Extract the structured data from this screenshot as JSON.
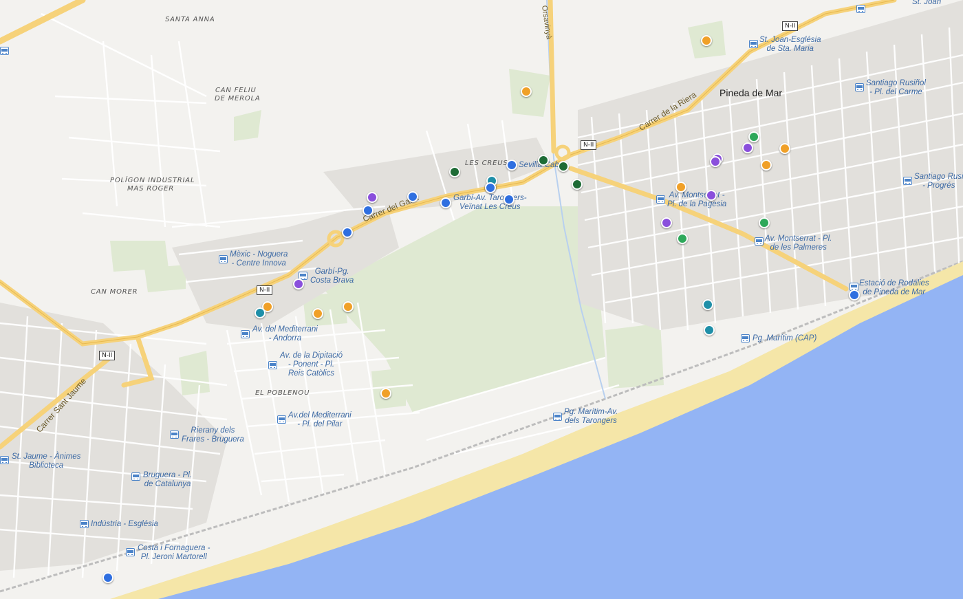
{
  "map": {
    "town": "Pineda de Mar",
    "places": [
      "SANTA ANNA",
      "CAN FELIU DE MERLA",
      "POLÍGON INDUSTRIAL MAS ROGER",
      "CAN MORER",
      "LES CREUS",
      "EL POBLENOU"
    ],
    "place_lines": {
      "santa_anna": "SANTA ANNA",
      "can_feliu_1": "CAN FELIU",
      "can_feliu_2": "DE MEROLA",
      "poligon_1": "POLÍGON INDUSTRIAL",
      "poligon_2": "MAS ROGER",
      "can_morer": "CAN MORER",
      "les_creus": "LES CREUS",
      "el_poblenou": "EL POBLENOU"
    },
    "roads": {
      "garbi": "Carrer del Garbí",
      "riera": "Carrer de la Riera",
      "sant_jaume": "Carrer Sant Jaume",
      "orsavinya": "Orsavinyà",
      "n2": "N-II"
    },
    "stops": {
      "st_joan": "St. Joan",
      "st_joan_esglesia_1": "St. Joan-Església",
      "st_joan_esglesia_2": "de Sta. Maria",
      "santiago_carme_1": "Santiago Rusiñol",
      "santiago_carme_2": "- Pl. del Carme",
      "santiago_progres_1": "Santiago Rusi",
      "santiago_progres_2": "- Progrés",
      "sevilla": "Sevilla-Cabria",
      "garbi_tarongers_1": "Garbí-Av. Tarongers-",
      "garbi_tarongers_2": "Veïnat Les Creus",
      "montserrat_pagesia_1": "Av. Montserrat -",
      "montserrat_pagesia_2": "Pl. de la Pagesia",
      "montserrat_palmeres_1": "Av. Montserrat - Pl.",
      "montserrat_palmeres_2": "de les Palmeres",
      "estacio_1": "Estació de Rodalies",
      "estacio_2": "de Pineda de Mar",
      "pg_maritim": "Pg. Marítim (CAP)",
      "mexic_1": "Mèxic - Noguera",
      "mexic_2": "- Centre Innova",
      "garbi_costa_1": "Garbí-Pg.",
      "garbi_costa_2": "Costa Brava",
      "mediterrani_andorra_1": "Av. del Mediterrani",
      "mediterrani_andorra_2": "- Andorra",
      "diputacio_1": "Av. de la Dipitació",
      "diputacio_2": "- Ponent - Pl.",
      "diputacio_3": "Reis Catòlics",
      "mediterrani_pilar_1": "Av.del Mediterrani",
      "mediterrani_pilar_2": "- Pl. del Pilar",
      "tarongers_1": "Pg. Marítim-Av.",
      "tarongers_2": "dels Tarongers",
      "rierany_1": "Rierany dels",
      "rierany_2": "Frares - Bruguera",
      "st_jaume_1": "St. Jaume - Ànimes",
      "st_jaume_2": "Biblioteca",
      "bruguera_1": "Bruguera - Pl.",
      "bruguera_2": "de Catalunya",
      "industria": "Indústria - Església",
      "costa_1": "Costa i Fornaguera -",
      "costa_2": "Pl. Jeroni Martorell"
    },
    "colors": {
      "sea": "#93b4f4",
      "beach": "#f5e6a8",
      "land": "#f3f2ef",
      "park": "#dfe9d2",
      "highway": "#f6d27a",
      "road": "#ffffff",
      "block": "#e3e1dd",
      "stop_text": "#3d6aa5"
    },
    "marker_colors": {
      "blue": "#2f6fe0",
      "orange": "#f0a028",
      "purple": "#8a4fdc",
      "teal": "#1f8fa8",
      "green": "#2ea85a",
      "darkgreen": "#1e6b35"
    },
    "markers": [
      {
        "category": "orange"
      },
      {
        "category": "orange"
      },
      {
        "category": "blue"
      },
      {
        "category": "darkgreen"
      },
      {
        "category": "darkgreen"
      },
      {
        "category": "darkgreen"
      },
      {
        "category": "darkgreen"
      },
      {
        "category": "blue"
      },
      {
        "category": "blue"
      },
      {
        "category": "teal"
      },
      {
        "category": "blue"
      },
      {
        "category": "blue"
      },
      {
        "category": "purple"
      },
      {
        "category": "blue"
      },
      {
        "category": "blue"
      },
      {
        "category": "blue"
      },
      {
        "category": "purple"
      },
      {
        "category": "orange"
      },
      {
        "category": "teal"
      },
      {
        "category": "orange"
      },
      {
        "category": "orange"
      },
      {
        "category": "orange"
      },
      {
        "category": "green"
      },
      {
        "category": "purple"
      },
      {
        "category": "orange"
      },
      {
        "category": "purple"
      },
      {
        "category": "purple"
      },
      {
        "category": "orange"
      },
      {
        "category": "purple"
      },
      {
        "category": "orange"
      },
      {
        "category": "purple"
      },
      {
        "category": "green"
      },
      {
        "category": "green"
      },
      {
        "category": "teal"
      },
      {
        "category": "teal"
      },
      {
        "category": "blue"
      },
      {
        "category": "blue"
      }
    ]
  }
}
